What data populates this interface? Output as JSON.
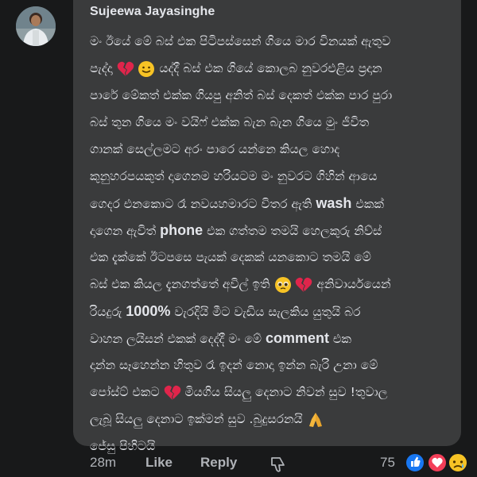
{
  "comment": {
    "author": "Sujeewa Jayasinghe",
    "lines": [
      "මං ඊයේ මේ බස් එක පිටිපස්සෙන් ගියෙ මාර විනයක් ඇතුව",
      "පැද්දා",
      "යද්දී බස් එක ගියේ කොලබ නුවරඑළිය ප්‍රදාන",
      "පාරේ මේකත් එක්ක ගියපු අනිත් බස් දෙකත් එක්ක පාර පුරා",
      "බස් තුන ගියෙ මං වයිෆ් එක්ක බැන බැන ගියෙ මුං ජීවිත",
      "ගානක් සෙල්ලමට අරං පාරෙ යන්නෙ කියල හොද",
      "කුනුහරපයකුත් දාගෙනම හරියටම මං නුවරට ගිහින් ආයෙ",
      "ගෙදර එනකොට රෑ නවයහමාරට විතර ඇති",
      "එකක්",
      "දාගෙන ඇවිත්",
      "එක ගත්තම තමයි හෙලකුරු නිව්ස්",
      "එක දැක්කේ ඊටපසෙ පැයක් දෙකක් යනකොට තමයි මේ",
      "බස් එක කියල දැනගත්තේ අවිල් ඉති",
      "අනිවාර්යයෙන්",
      "රියදුරු",
      "වැරදියි මීට වැඩිය සැලකිය යුතුයි බර",
      "වාහන ලයිසන් එකක් දෙද්දී මං මේ",
      "එක",
      "දාන්න සෑහෙන්න හිතුව රෑ ඉදන් නොදා ඉන්න බැරි උනා මේ",
      "පෝස්ට් එකට",
      "මියගිය සියලු දෙනාට නිවන් සුව !තුවාල",
      "ලැබූ සියලු දෙනාට ඉක්මන් සුව .බුදුසරනයි",
      "ජේසු පිහිටයි"
    ],
    "latin": {
      "wash": "wash",
      "phone": "phone",
      "percent": "1000%",
      "comment": "comment"
    }
  },
  "footer": {
    "time": "28m",
    "like_label": "Like",
    "reply_label": "Reply",
    "reaction_count": "75"
  },
  "icons": {
    "avatar": "avatar",
    "reply_icon": "thumbs-down-icon",
    "reactions": [
      "like-reaction-icon",
      "love-reaction-icon",
      "sad-reaction-icon"
    ],
    "emoji": [
      "broken-heart-icon",
      "smiley-icon",
      "pleading-face-icon",
      "folded-hands-icon"
    ]
  }
}
